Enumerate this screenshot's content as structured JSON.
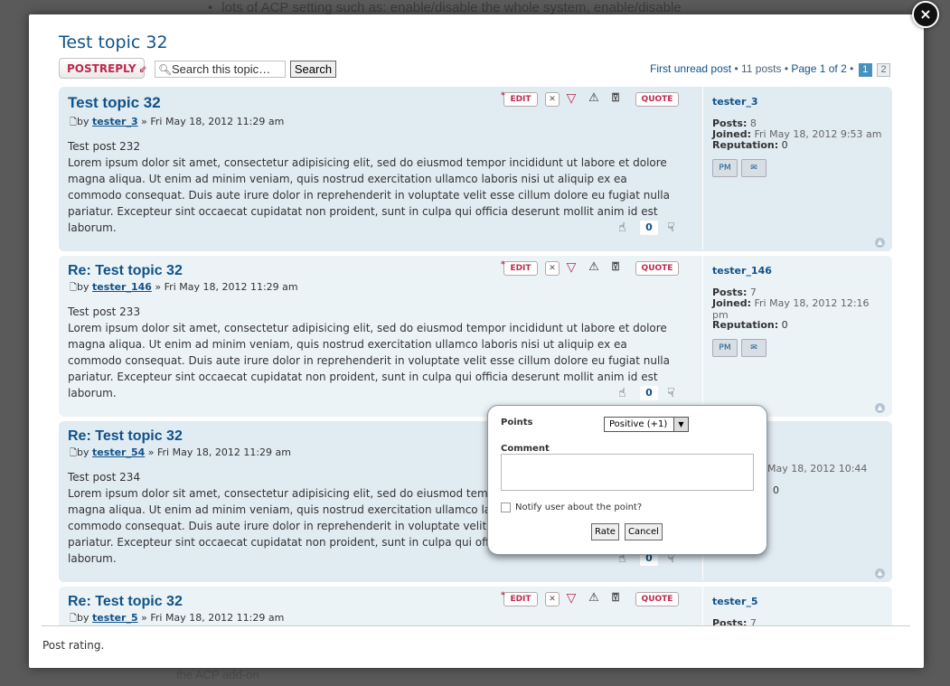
{
  "background": {
    "top_text": "lots of ACP setting such as: enable/disable the whole system, enable/disable",
    "bottom_text": "the ACP add-on"
  },
  "modal": {
    "close_label": "×",
    "footer_text": "Post rating."
  },
  "topic": {
    "title": "Test topic 32",
    "postreply_label": "POSTREPLY",
    "search_placeholder": "Search this topic…",
    "search_button": "Search",
    "first_unread": "First unread post",
    "post_count": "11 posts",
    "page_info": "Page 1 of 2",
    "pages": [
      "1",
      "2"
    ]
  },
  "tools": {
    "edit": "EDIT",
    "quote": "QUOTE"
  },
  "labels": {
    "by": "by",
    "date_sep": "»",
    "posts": "Posts:",
    "joined": "Joined:",
    "reputation": "Reputation:",
    "pm": "PM"
  },
  "posts": [
    {
      "title": "Test topic 32",
      "author": "tester_3",
      "date": "Fri May 18, 2012 11:29 am",
      "first_line": "Test post 232",
      "body": "Lorem ipsum dolor sit amet, consectetur adipisicing elit, sed do eiusmod tempor incididunt ut labore et dolore magna aliqua. Ut enim ad minim veniam, quis nostrud exercitation ullamco laboris nisi ut aliquip ex ea commodo consequat. Duis aute irure dolor in reprehenderit in voluptate velit esse cillum dolore eu fugiat nulla pariatur. Excepteur sint occaecat cupidatat non proident, sunt in culpa qui officia deserunt mollit anim id est laborum.",
      "profile_posts": "8",
      "joined": "Fri May 18, 2012 9:53 am",
      "reputation": "0",
      "rating": "0"
    },
    {
      "title": "Re: Test topic 32",
      "author": "tester_146",
      "date": "Fri May 18, 2012 11:29 am",
      "first_line": "Test post 233",
      "body": "Lorem ipsum dolor sit amet, consectetur adipisicing elit, sed do eiusmod tempor incididunt ut labore et dolore magna aliqua. Ut enim ad minim veniam, quis nostrud exercitation ullamco laboris nisi ut aliquip ex ea commodo consequat. Duis aute irure dolor in reprehenderit in voluptate velit esse cillum dolore eu fugiat nulla pariatur. Excepteur sint occaecat cupidatat non proident, sunt in culpa qui officia deserunt mollit anim id est laborum.",
      "profile_posts": "7",
      "joined": "Fri May 18, 2012 12:16 pm",
      "reputation": "0",
      "rating": "0"
    },
    {
      "title": "Re: Test topic 32",
      "author": "tester_54",
      "date": "Fri May 18, 2012 11:29 am",
      "first_line": "Test post 234",
      "body": "Lorem ipsum dolor sit amet, consectetur adipisicing elit, sed do eiusmod tempor incididunt ut labore et dolore magna aliqua. Ut enim ad minim veniam, quis nostrud exercitation ullamco laboris nisi ut aliquip ex ea commodo consequat. Duis aute irure dolor in reprehenderit in voluptate velit esse cillum dolore eu fugiat nulla pariatur. Excepteur sint occaecat cupidatat non proident, sunt in culpa qui officia deserunt mollit anim id est laborum.",
      "joined_partial": "May 18, 2012 10:44",
      "reputation": "0",
      "rating": "0"
    },
    {
      "title": "Re: Test topic 32",
      "author": "tester_5",
      "date": "Fri May 18, 2012 11:29 am",
      "profile_posts": "7"
    }
  ],
  "rate_popup": {
    "points_label": "Points",
    "points_value": "Positive (+1)",
    "comment_label": "Comment",
    "notify_label": "Notify user about the point?",
    "rate_button": "Rate",
    "cancel_button": "Cancel"
  }
}
